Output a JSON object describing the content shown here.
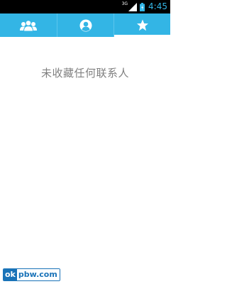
{
  "status_bar": {
    "network": "3G",
    "time": "4:45",
    "icons": [
      "signal-icon",
      "battery-icon"
    ]
  },
  "tabs": [
    {
      "name": "groups",
      "icon": "group-icon",
      "selected": false
    },
    {
      "name": "contacts",
      "icon": "person-icon",
      "selected": false
    },
    {
      "name": "favorites",
      "icon": "star-icon",
      "selected": true
    }
  ],
  "main": {
    "empty_message": "未收藏任何联系人"
  },
  "watermark": {
    "part1": "ok",
    "part2": "pbw.com"
  },
  "colors": {
    "tab_bar": "#33b5e5",
    "clock": "#33b5e5",
    "empty_text": "#808080"
  }
}
